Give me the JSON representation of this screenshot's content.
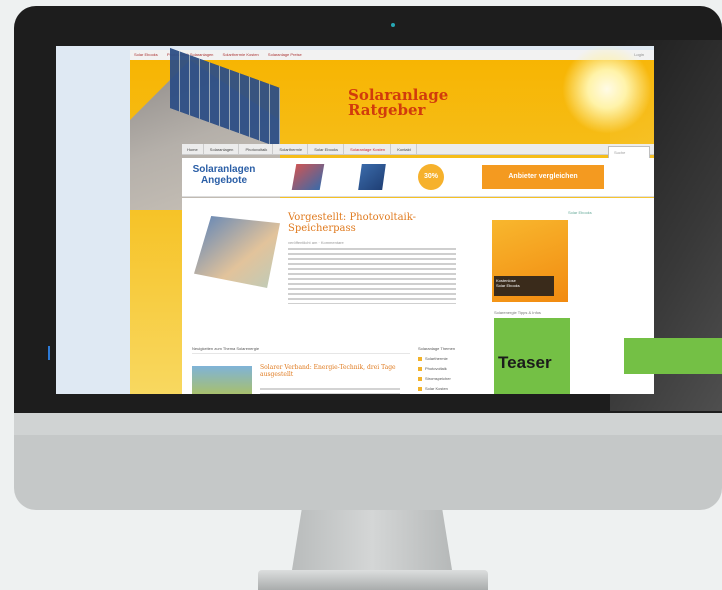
{
  "site": {
    "topbar_links": [
      "Solar Ebooks",
      "Photovoltaik Solaranlagen",
      "Solarthermie Kosten",
      "Solaranlage Preise"
    ],
    "topbar_right": "Login",
    "logo": {
      "line1": "Solaranlage",
      "line2": "Ratgeber"
    },
    "nav_items": [
      "Home",
      "Solaranlagen",
      "Photovoltaik",
      "Solarthermie",
      "Solar Ebooks",
      "Solaranlage Kosten",
      "Kontakt"
    ],
    "nav_search_placeholder": "Suche",
    "ad": {
      "title_line1": "Solaranlagen",
      "title_line2": "Angebote",
      "badge": "30%",
      "button": "Anbieter vergleichen"
    },
    "post": {
      "title": "Vorgestellt: Photovoltaik-Speicherpass",
      "meta": "veröffentlicht am · Kommentare"
    },
    "side_link": "Solar Ebooks",
    "side_ad_label_line1": "Kostenlose",
    "side_ad_label_line2": "Solar Ebooks",
    "side_caption": "Solarenergie Tipps & Infos",
    "teaser_label": "Teaser",
    "section_title": "Neuigkeiten zum Thema Solarenergie",
    "post2_title": "Solarer Verband: Energie-Technik, drei Tage ausgestellt",
    "categories_title": "Solaranlage Themen",
    "categories": [
      "Solarthermie",
      "Photovoltaik",
      "Stromspeicher",
      "Solar Kosten"
    ]
  },
  "colors": {
    "teaser": "#74c045",
    "accent_orange": "#f49a20",
    "logo_red": "#d13b0c"
  }
}
